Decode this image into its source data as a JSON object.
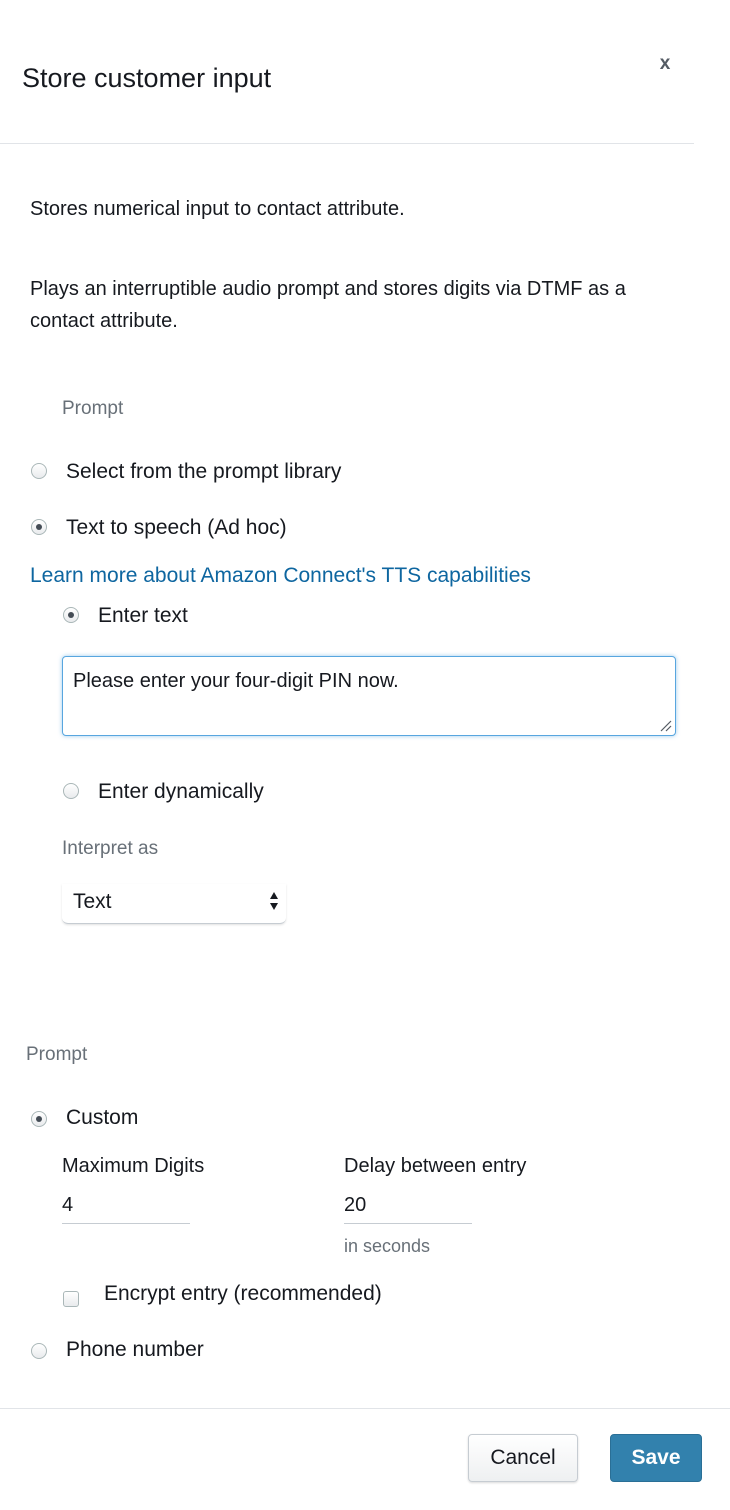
{
  "header": {
    "title": "Store customer input",
    "close_label": "x"
  },
  "description": {
    "line1": "Stores numerical input to contact attribute.",
    "line2": "Plays an interruptible audio prompt and stores digits via DTMF as a contact attribute."
  },
  "prompt_section": {
    "label": "Prompt",
    "options": [
      {
        "label": "Select from the prompt library",
        "checked": false
      },
      {
        "label": "Text to speech (Ad hoc)",
        "checked": true
      }
    ],
    "learn_more_link": "Learn more about Amazon Connect's TTS capabilities",
    "tts_options": [
      {
        "label": "Enter text",
        "checked": true
      },
      {
        "label": "Enter dynamically",
        "checked": false
      }
    ],
    "text_value": "Please enter your four-digit PIN now.",
    "interpret_as_label": "Interpret as",
    "interpret_as_value": "Text"
  },
  "input_section": {
    "label": "Prompt",
    "custom_label": "Custom",
    "custom_checked": true,
    "max_digits_label": "Maximum Digits",
    "max_digits_value": "4",
    "delay_label": "Delay between entry",
    "delay_value": "20",
    "delay_hint": "in seconds",
    "encrypt_label": "Encrypt entry (recommended)",
    "encrypt_checked": false,
    "phone_label": "Phone number",
    "phone_checked": false
  },
  "footer": {
    "cancel_label": "Cancel",
    "save_label": "Save"
  },
  "colors": {
    "link": "#0e66a0",
    "primary_button": "#3281ad",
    "focus_border": "#58a6df"
  }
}
